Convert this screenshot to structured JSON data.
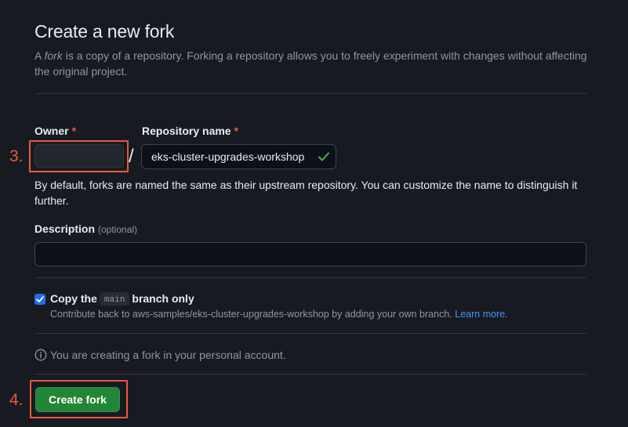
{
  "header": {
    "title": "Create a new fork",
    "intro_prefix": "A ",
    "intro_em": "fork",
    "intro_rest": " is a copy of a repository. Forking a repository allows you to freely experiment with changes without affecting the original project."
  },
  "owner": {
    "label": "Owner",
    "required_mark": "*",
    "annotation": "3."
  },
  "repo": {
    "label": "Repository name",
    "required_mark": "*",
    "value": "eks-cluster-upgrades-workshop",
    "separator": "/"
  },
  "helper_text": "By default, forks are named the same as their upstream repository. You can customize the name to distinguish it further.",
  "description": {
    "label": "Description",
    "optional": "(optional)",
    "value": ""
  },
  "copy_branch": {
    "checked": true,
    "label_prefix": "Copy the",
    "branch": "main",
    "label_suffix": "branch only",
    "sub_text": "Contribute back to aws-samples/eks-cluster-upgrades-workshop by adding your own branch.",
    "learn_more": "Learn more."
  },
  "info": {
    "icon": "info-icon",
    "text": "You are creating a fork in your personal account."
  },
  "submit": {
    "label": "Create fork",
    "annotation": "4."
  },
  "colors": {
    "background": "#171b21",
    "primary_button": "#238636",
    "annotation": "#e8593c",
    "link": "#4493f8",
    "checkbox": "#1f6feb",
    "valid_check": "#3fb950"
  }
}
